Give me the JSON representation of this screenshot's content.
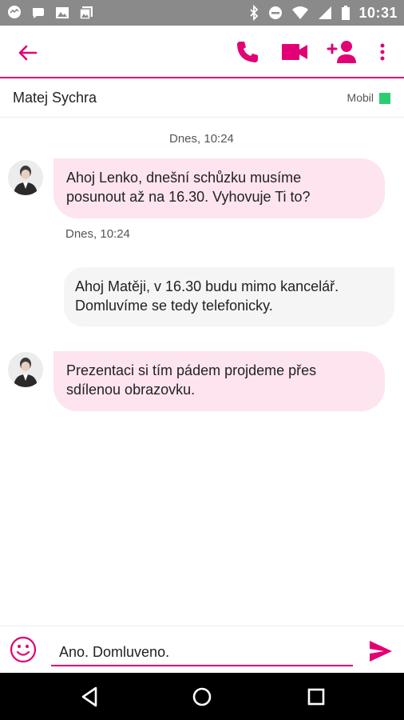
{
  "status_bar": {
    "time": "10:31",
    "icons_left": [
      "messenger-icon",
      "chat-icon",
      "image-icon",
      "gallery-icon"
    ],
    "icons_right": [
      "bluetooth-icon",
      "do-not-disturb-icon",
      "wifi-icon",
      "signal-icon",
      "battery-icon"
    ]
  },
  "app_bar": {
    "accent": "#e20074",
    "actions": [
      "back-arrow-icon",
      "phone-icon",
      "video-icon",
      "add-contact-icon",
      "more-vert-icon"
    ]
  },
  "contact": {
    "name": "Matej Sychra",
    "type": "Mobil",
    "presence_color": "#2ecc71"
  },
  "messages": [
    {
      "timestamp": "Dnes, 10:24"
    },
    {
      "direction": "incoming",
      "text_line1": "Ahoj Lenko, dnešní schůzku musíme",
      "text_line2": "posunout až na 16.30. Vyhovuje Ti to?",
      "timestamp_after": "Dnes, 10:24"
    },
    {
      "direction": "outgoing",
      "text_line1": "Ahoj Matěji, v 16.30 budu mimo kancelář.",
      "text_line2": "Domluvíme se tedy telefonicky."
    },
    {
      "direction": "incoming",
      "text_line1": "Prezentaci si tím pádem projdeme přes",
      "text_line2": "sdílenou obrazovku."
    }
  ],
  "composer": {
    "value": "Ano. Domluveno."
  },
  "nav_bar": [
    "back-nav-icon",
    "home-nav-icon",
    "recents-nav-icon"
  ]
}
